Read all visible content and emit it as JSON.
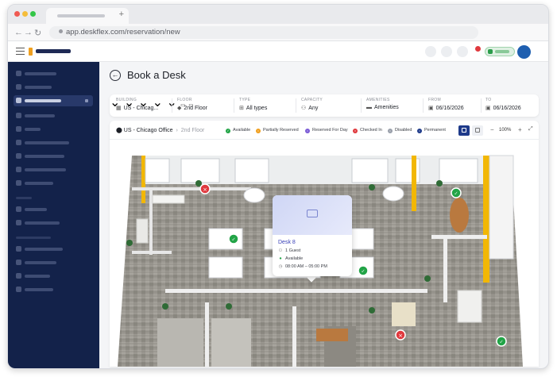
{
  "browser": {
    "url": "app.deskflex.com/reservation/new"
  },
  "page": {
    "title": "Book a Desk"
  },
  "filters": [
    {
      "label": "BUILDING",
      "value": "US - Chicag...",
      "icon": "building-icon"
    },
    {
      "label": "FLOOR",
      "value": "2nd Floor",
      "icon": "floor-icon"
    },
    {
      "label": "TYPE",
      "value": "All types",
      "icon": "desk-type-icon"
    },
    {
      "label": "CAPACITY",
      "value": "Any",
      "icon": "people-icon"
    },
    {
      "label": "AMENITIES",
      "value": "Amenities",
      "icon": "amenities-icon"
    },
    {
      "label": "FROM",
      "value": "06/16/2026",
      "icon": "calendar-icon"
    },
    {
      "label": "TO",
      "value": "06/16/2026",
      "icon": "calendar-icon"
    }
  ],
  "map": {
    "location": "US - Chicago Office",
    "floor": "2nd Floor",
    "zoom": "100%",
    "legend": [
      {
        "label": "Available",
        "color": "#22a447"
      },
      {
        "label": "Partially Reserved",
        "color": "#f0a020"
      },
      {
        "label": "Reserved For Day",
        "color": "#7b5cd6"
      },
      {
        "label": "Checked In",
        "color": "#e0393e"
      },
      {
        "label": "Disabled",
        "color": "#9aa0ab"
      },
      {
        "label": "Permanent",
        "color": "#1e3a8a"
      }
    ]
  },
  "popup": {
    "title": "Desk 8",
    "guests": "1 Guest",
    "status": "Available",
    "time": "08:00 AM – 05:00 PM"
  },
  "colors": {
    "sidebar": "#13224a",
    "accent": "#1e3a8a",
    "wall_accent": "#f2b705",
    "available": "#22a447",
    "checked_in": "#e0393e"
  }
}
